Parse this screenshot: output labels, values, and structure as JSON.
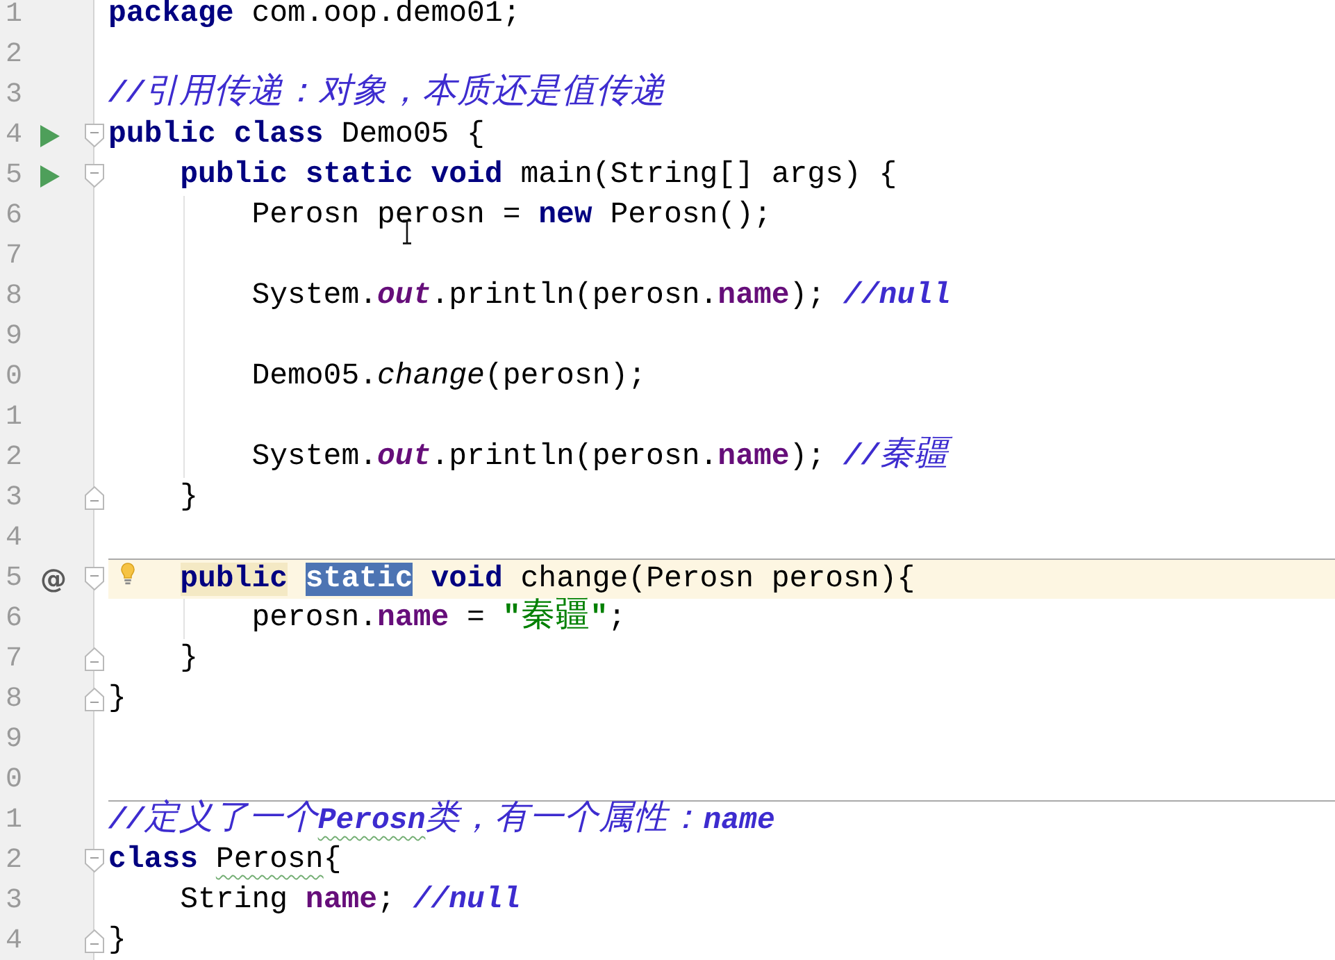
{
  "editor": {
    "lines": [
      {
        "number": "1",
        "current": false,
        "separator": false,
        "tokens": [
          {
            "text": "package",
            "kind": "keyword"
          },
          {
            "text": " com.oop.demo01;",
            "kind": "plain"
          }
        ]
      },
      {
        "number": "2",
        "current": false,
        "separator": false
      },
      {
        "number": "3",
        "current": false,
        "separator": false,
        "tokens": [
          {
            "text": "//引用传递：对象，本质还是值传递",
            "kind": "comment"
          }
        ]
      },
      {
        "number": "4",
        "markers": [
          {
            "kind": "run"
          },
          {
            "kind": "fold_start"
          }
        ],
        "current": false,
        "separator": false,
        "tokens": [
          {
            "text": "public class",
            "kind": "keyword"
          },
          {
            "text": " Demo05 {",
            "kind": "plain"
          }
        ],
        "children": [
          {
            "number": "5",
            "markers": [
              {
                "kind": "run"
              },
              {
                "kind": "fold_start"
              }
            ],
            "current": false,
            "separator": false,
            "tokens": [
              {
                "text": "public static void",
                "kind": "keyword"
              },
              {
                "text": " main(String[] args) {",
                "kind": "plain"
              }
            ],
            "children": [
              {
                "number": "6",
                "current": false,
                "separator": false,
                "tokens": [
                  {
                    "text": "Perosn perosn = ",
                    "kind": "plain"
                  },
                  {
                    "text": "new",
                    "kind": "keyword"
                  },
                  {
                    "text": " Perosn();",
                    "kind": "plain"
                  }
                ]
              },
              {
                "number": "7",
                "current": false,
                "separator": false
              },
              {
                "number": "8",
                "current": false,
                "separator": false,
                "tokens": [
                  {
                    "text": "System.",
                    "kind": "plain"
                  },
                  {
                    "text": "out",
                    "kind": "static_field"
                  },
                  {
                    "text": ".println(perosn.",
                    "kind": "plain"
                  },
                  {
                    "text": "name",
                    "kind": "field"
                  },
                  {
                    "text": "); ",
                    "kind": "plain"
                  },
                  {
                    "text": "//null",
                    "kind": "comment"
                  }
                ]
              },
              {
                "number": "9",
                "current": false,
                "separator": false
              },
              {
                "number": "0",
                "current": false,
                "separator": false,
                "tokens": [
                  {
                    "text": "Demo05.",
                    "kind": "plain"
                  },
                  {
                    "text": "change",
                    "kind": "static_call"
                  },
                  {
                    "text": "(perosn);",
                    "kind": "plain"
                  }
                ]
              },
              {
                "number": "1",
                "current": false,
                "separator": false
              },
              {
                "number": "2",
                "current": false,
                "separator": false,
                "tokens": [
                  {
                    "text": "System.",
                    "kind": "plain"
                  },
                  {
                    "text": "out",
                    "kind": "static_field"
                  },
                  {
                    "text": ".println(perosn.",
                    "kind": "plain"
                  },
                  {
                    "text": "name",
                    "kind": "field"
                  },
                  {
                    "text": "); ",
                    "kind": "plain"
                  },
                  {
                    "text": "//秦疆",
                    "kind": "comment"
                  }
                ]
              }
            ]
          },
          {
            "number": "3",
            "markers": [
              {
                "kind": "fold_end"
              }
            ],
            "current": false,
            "separator": false,
            "tokens": [
              {
                "text": "}",
                "kind": "plain"
              }
            ]
          },
          {
            "number": "4",
            "current": false,
            "separator": false
          },
          {
            "number": "5",
            "gutter_mark": "@",
            "markers": [
              {
                "kind": "fold_start"
              },
              {
                "kind": "bulb"
              }
            ],
            "current": true,
            "separator": true,
            "tokens": [
              {
                "text": "public",
                "kind": "keyword",
                "highlight": {
                  "kind": "usage"
                }
              },
              {
                "text": " static",
                "kind": "keyword",
                "highlight": {
                  "kind": "selection"
                }
              },
              {
                "text": " void",
                "kind": "keyword"
              },
              {
                "text": " change(Perosn perosn){",
                "kind": "plain"
              }
            ],
            "children": [
              {
                "number": "6",
                "current": false,
                "separator": false,
                "tokens": [
                  {
                    "text": "perosn.",
                    "kind": "plain"
                  },
                  {
                    "text": "name",
                    "kind": "field"
                  },
                  {
                    "text": " = ",
                    "kind": "plain"
                  },
                  {
                    "text": "\"秦疆\"",
                    "kind": "string"
                  },
                  {
                    "text": ";",
                    "kind": "plain"
                  }
                ]
              }
            ]
          },
          {
            "number": "7",
            "markers": [
              {
                "kind": "fold_end"
              }
            ],
            "current": false,
            "separator": false,
            "tokens": [
              {
                "text": "}",
                "kind": "plain"
              }
            ]
          }
        ]
      },
      {
        "number": "8",
        "markers": [
          {
            "kind": "fold_end"
          }
        ],
        "current": false,
        "separator": false,
        "tokens": [
          {
            "text": "}",
            "kind": "plain"
          }
        ]
      },
      {
        "number": "9",
        "current": false,
        "separator": false
      },
      {
        "number": "0",
        "current": false,
        "separator": false
      },
      {
        "number": "1",
        "current": false,
        "separator": true,
        "tokens": [
          {
            "text": "//定义了一个",
            "kind": "comment"
          },
          {
            "text": "Perosn",
            "kind": "comment",
            "highlight": {
              "kind": "typo"
            }
          },
          {
            "text": "类，有一个属性：name",
            "kind": "comment"
          }
        ]
      },
      {
        "number": "2",
        "markers": [
          {
            "kind": "fold_start"
          }
        ],
        "current": false,
        "separator": false,
        "tokens": [
          {
            "text": "class",
            "kind": "keyword"
          },
          {
            "text": " Perosn",
            "kind": "plain",
            "highlight": {
              "kind": "typo"
            }
          },
          {
            "text": "{",
            "kind": "plain"
          }
        ],
        "children": [
          {
            "number": "3",
            "current": false,
            "separator": false,
            "tokens": [
              {
                "text": "String ",
                "kind": "plain"
              },
              {
                "text": "name",
                "kind": "field"
              },
              {
                "text": "; ",
                "kind": "plain"
              },
              {
                "text": "//null",
                "kind": "comment"
              }
            ]
          }
        ]
      },
      {
        "number": "4",
        "markers": [
          {
            "kind": "fold_end"
          }
        ],
        "current": false,
        "separator": false,
        "tokens": [
          {
            "text": "}",
            "kind": "plain"
          }
        ]
      }
    ]
  }
}
